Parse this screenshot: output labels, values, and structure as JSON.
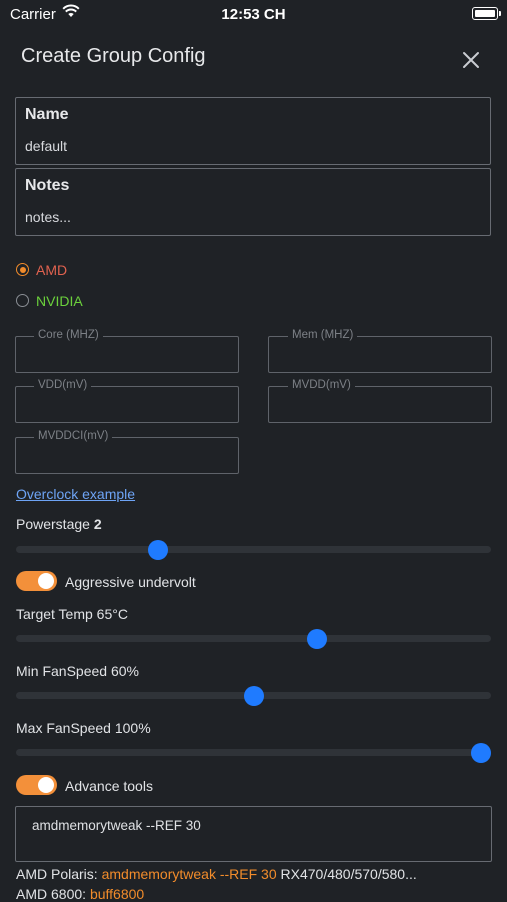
{
  "status_bar": {
    "carrier": "Carrier",
    "time": "12:53 CH"
  },
  "header": {
    "title": "Create Group Config"
  },
  "name_field": {
    "label": "Name",
    "value": "default"
  },
  "notes_field": {
    "label": "Notes",
    "value": "notes..."
  },
  "gpu_options": [
    {
      "label": "AMD",
      "selected": true,
      "color": "#e0624f"
    },
    {
      "label": "NVIDIA",
      "selected": false,
      "color": "#6bd13c"
    }
  ],
  "overclock_fields": {
    "core": "Core (MHZ)",
    "mem": "Mem (MHZ)",
    "vdd": "VDD(mV)",
    "mvdd": "MVDD(mV)",
    "mvddci": "MVDDCI(mV)"
  },
  "overclock_link": "Overclock example",
  "powerstage": {
    "label": "Powerstage",
    "value": "2",
    "level": 0.29
  },
  "aggressive_undervolt": {
    "label": "Aggressive undervolt",
    "on": true
  },
  "target_temp": {
    "label": "Target Temp 65°C",
    "level": 0.64
  },
  "min_fanspeed": {
    "label": "Min FanSpeed 60%",
    "level": 0.5
  },
  "max_fanspeed": {
    "label": "Max FanSpeed 100%",
    "level": 1.0
  },
  "advance_tools": {
    "label": "Advance tools",
    "on": true
  },
  "tools_text": "amdmemorytweak --REF 30",
  "hints": [
    {
      "prefix": "AMD Polaris: ",
      "cmd": "amdmemorytweak --REF 30",
      "suffix": " RX470/480/570/580..."
    },
    {
      "prefix": "AMD 6800: ",
      "cmd": "buff6800",
      "suffix": ""
    }
  ],
  "colors": {
    "accent": "#f28c2b",
    "slider": "#1f7bff",
    "link": "#6ea4f5"
  }
}
